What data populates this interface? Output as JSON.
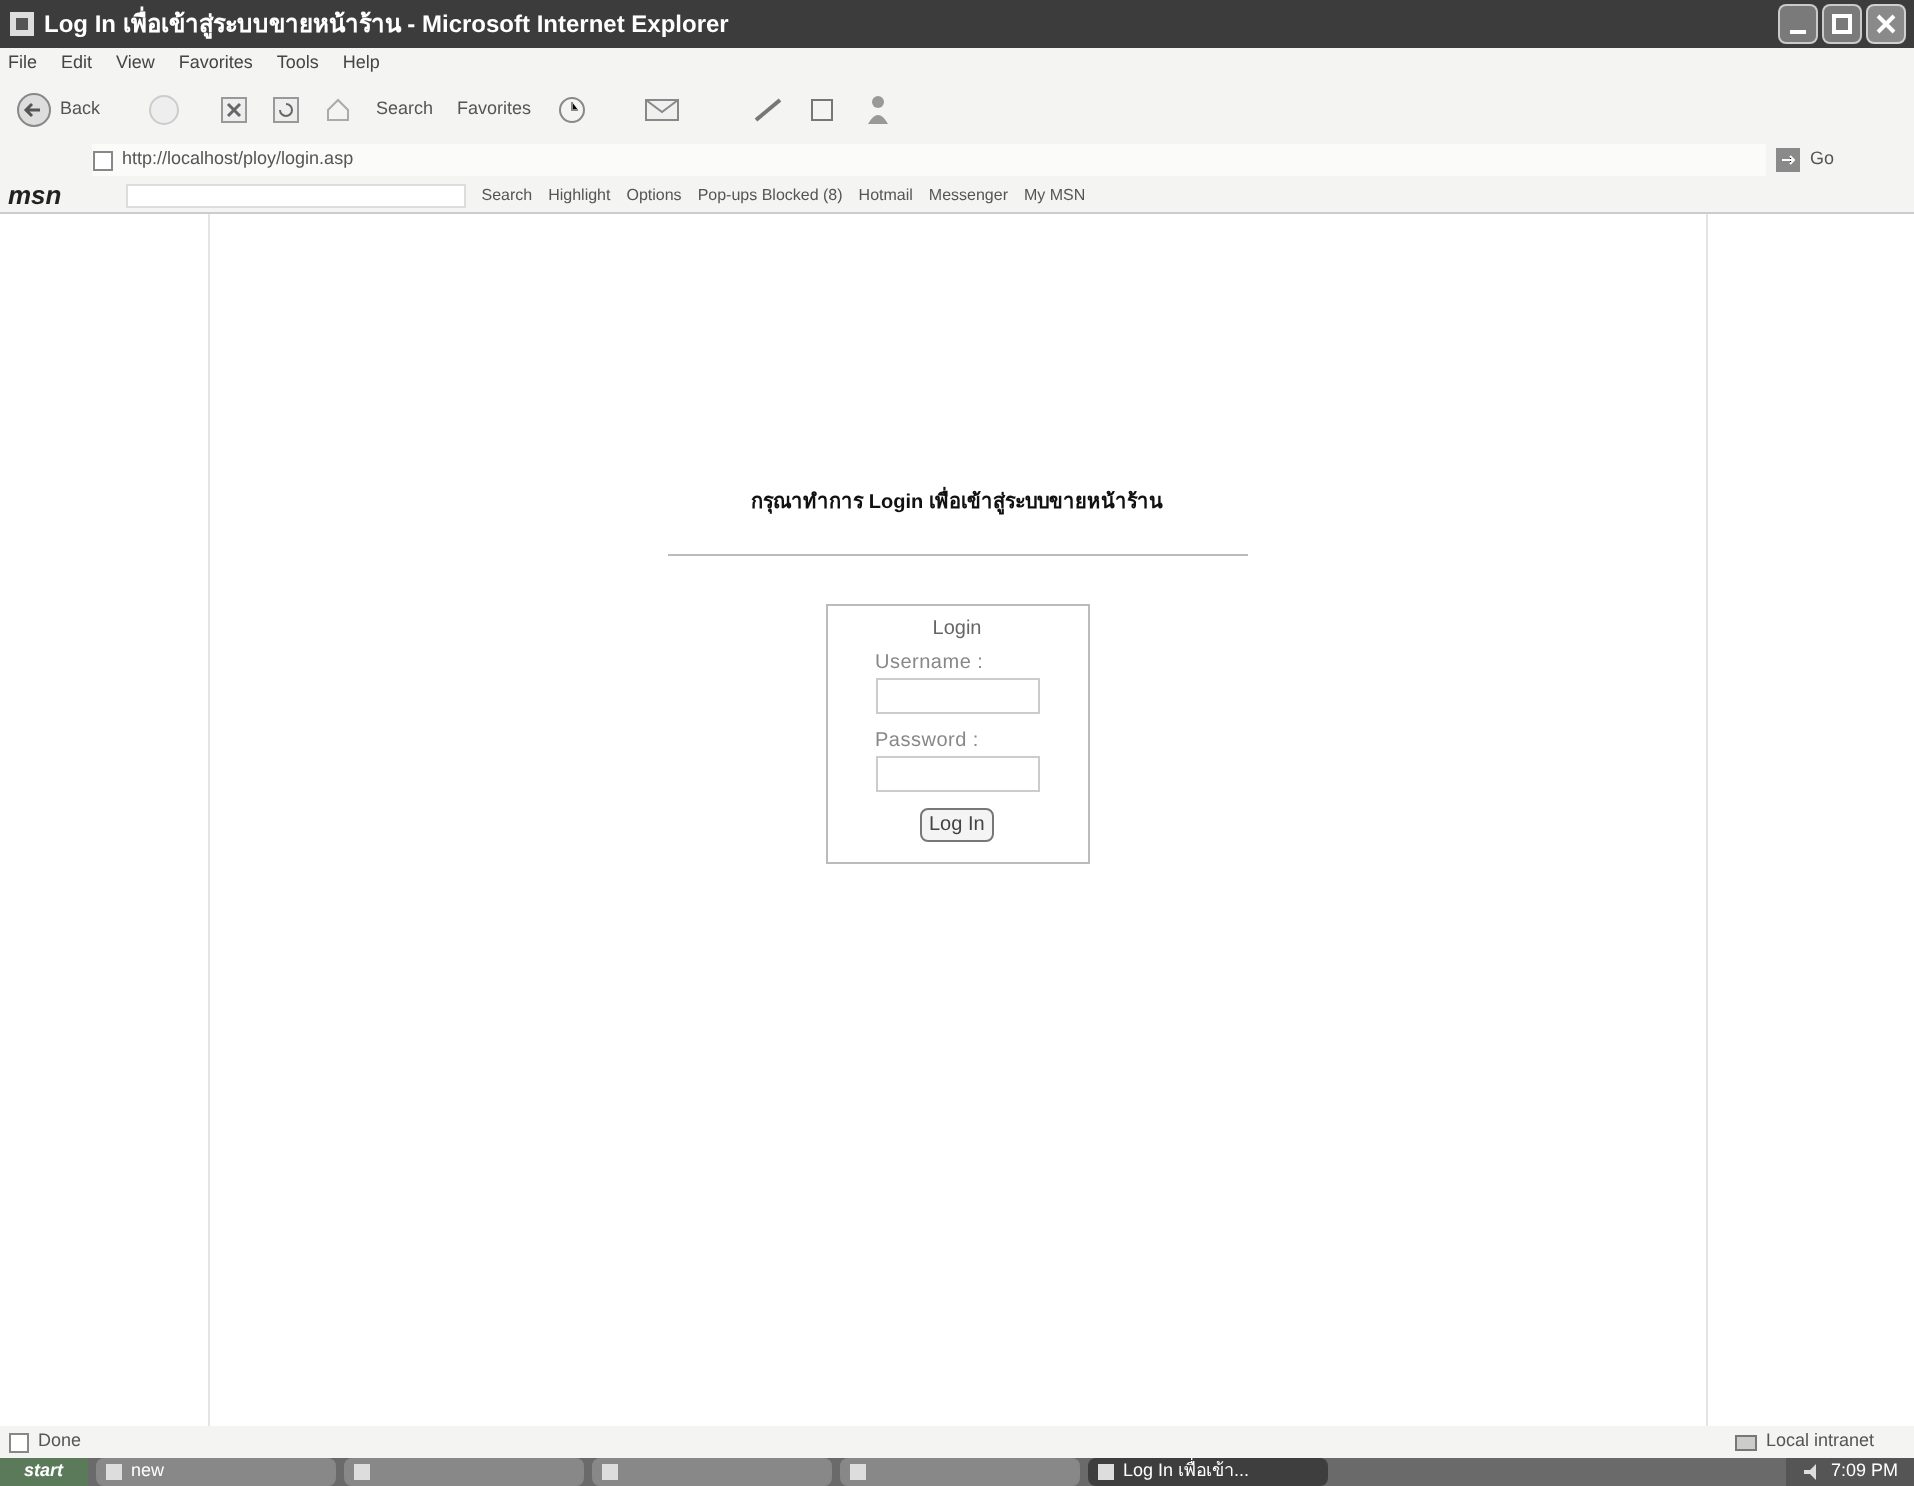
{
  "window": {
    "title": "Log In เพื่อเข้าสู่ระบบขายหน้าร้าน - Microsoft Internet Explorer"
  },
  "menu": [
    "File",
    "Edit",
    "View",
    "Favorites",
    "Tools",
    "Help"
  ],
  "toolbar": {
    "back": "Back",
    "search": "Search",
    "favorites": "Favorites"
  },
  "address": {
    "url": "http://localhost/ploy/login.asp",
    "go": "Go"
  },
  "msn_bar": {
    "logo": "msn",
    "search": "Search",
    "highlight": "Highlight",
    "options": "Options",
    "popups": "Pop-ups Blocked (8)",
    "hotmail": "Hotmail",
    "messenger": "Messenger",
    "my_msn": "My MSN"
  },
  "page": {
    "heading": "กรุณาทำการ Login เพื่อเข้าสู่ระบบขายหน้าร้าน",
    "login_box": {
      "title": "Login",
      "fields": [
        {
          "label": "Username :"
        },
        {
          "label": "Password :"
        }
      ],
      "button": "Log In"
    }
  },
  "status_bar": {
    "status": "Done",
    "zone": "Local intranet"
  },
  "taskbar": {
    "start": "start",
    "items": [
      {
        "label": "new",
        "selected": false
      },
      {
        "selected": false
      },
      {
        "selected": false
      },
      {
        "selected": false
      },
      {
        "label": "Log In เพื่อเข้า...",
        "selected": true
      }
    ],
    "clock": "7:09 PM"
  }
}
